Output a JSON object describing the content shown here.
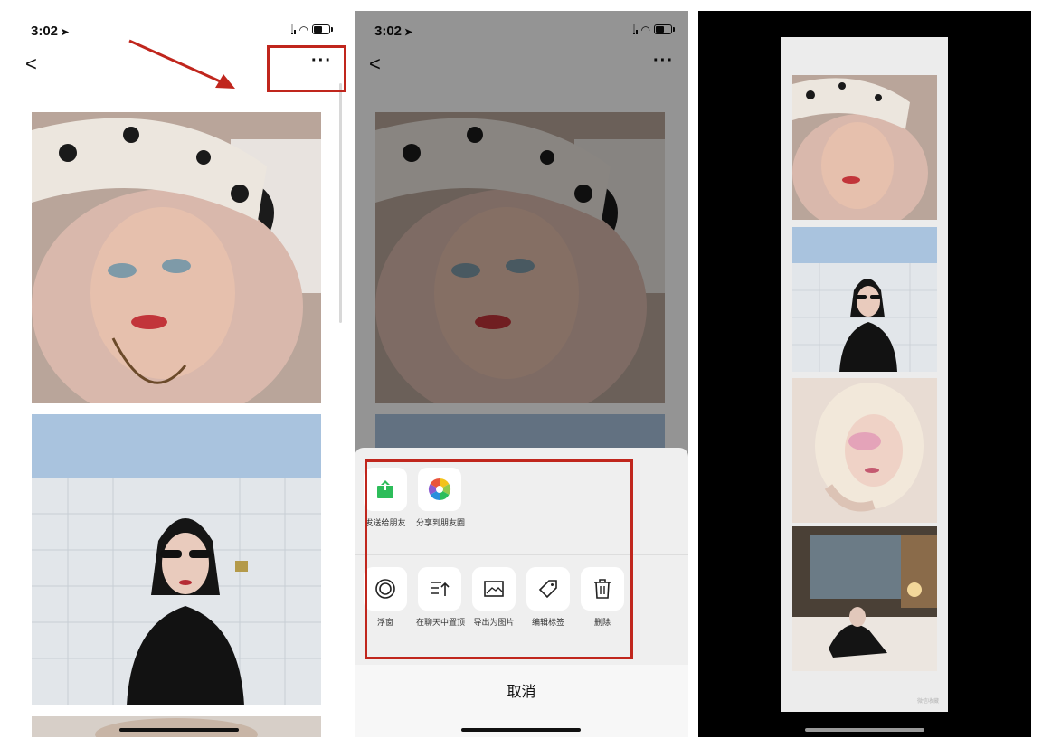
{
  "status_bar": {
    "time": "3:02",
    "location_arrow": "location-arrow-icon"
  },
  "nav": {
    "back_icon": "chevron-left-icon",
    "more_label": "···"
  },
  "action_sheet": {
    "share_row": [
      {
        "label": "发送给朋友",
        "icon": "share-to-friend-icon",
        "color": "#2dbd5a"
      },
      {
        "label": "分享到朋友圈",
        "icon": "moments-aperture-icon",
        "color": "#e9543b"
      }
    ],
    "action_row": [
      {
        "label": "浮窗",
        "icon": "float-window-icon"
      },
      {
        "label": "在聊天中置顶",
        "icon": "pin-to-top-icon"
      },
      {
        "label": "导出为图片",
        "icon": "export-image-icon"
      },
      {
        "label": "编辑标签",
        "icon": "tag-icon"
      },
      {
        "label": "删除",
        "icon": "trash-icon"
      }
    ],
    "cancel_label": "取消"
  },
  "export_preview": {
    "watermark": "微信收藏"
  },
  "colors": {
    "annotation_red": "#c0261d",
    "sheet_bg": "#efefef",
    "wechat_green": "#2dbd5a"
  }
}
